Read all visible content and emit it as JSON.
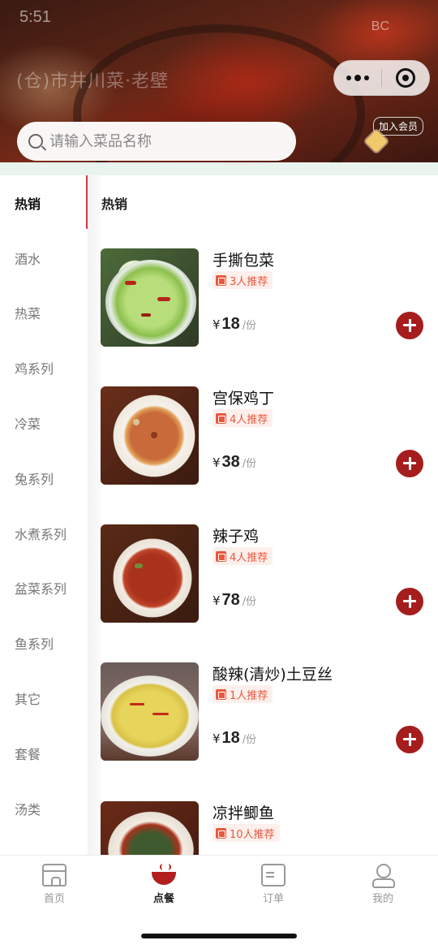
{
  "status_bar": {
    "time": "5:51",
    "right": "BC"
  },
  "header": {
    "store_name": "(仓)市井川菜·老壁",
    "search_placeholder": "请输入菜品名称",
    "member_label": "加入会员",
    "capsule": {
      "more_icon": "more-dots-icon",
      "close_icon": "target-close-icon"
    }
  },
  "sidebar": {
    "items": [
      {
        "label": "热销",
        "active": true
      },
      {
        "label": "酒水"
      },
      {
        "label": "热菜"
      },
      {
        "label": "鸡系列"
      },
      {
        "label": "冷菜"
      },
      {
        "label": "兔系列"
      },
      {
        "label": "水煮系列"
      },
      {
        "label": "盆菜系列"
      },
      {
        "label": "鱼系列"
      },
      {
        "label": "其它"
      },
      {
        "label": "套餐"
      },
      {
        "label": "汤类"
      }
    ]
  },
  "content": {
    "section_title": "热销",
    "currency": "¥",
    "unit": "/份",
    "dishes": [
      {
        "name": "手撕包菜",
        "rec": "3人推荐",
        "price": "18"
      },
      {
        "name": "宫保鸡丁",
        "rec": "4人推荐",
        "price": "38"
      },
      {
        "name": "辣子鸡",
        "rec": "4人推荐",
        "price": "78"
      },
      {
        "name": "酸辣(清炒)土豆丝",
        "rec": "1人推荐",
        "price": "18"
      },
      {
        "name": "凉拌鲫鱼",
        "rec": "10人推荐",
        "price": ""
      }
    ]
  },
  "tabbar": {
    "tabs": [
      {
        "label": "首页",
        "icon": "shop-icon"
      },
      {
        "label": "点餐",
        "icon": "bowl-icon",
        "active": true
      },
      {
        "label": "订单",
        "icon": "order-icon"
      },
      {
        "label": "我的",
        "icon": "user-icon"
      }
    ]
  }
}
